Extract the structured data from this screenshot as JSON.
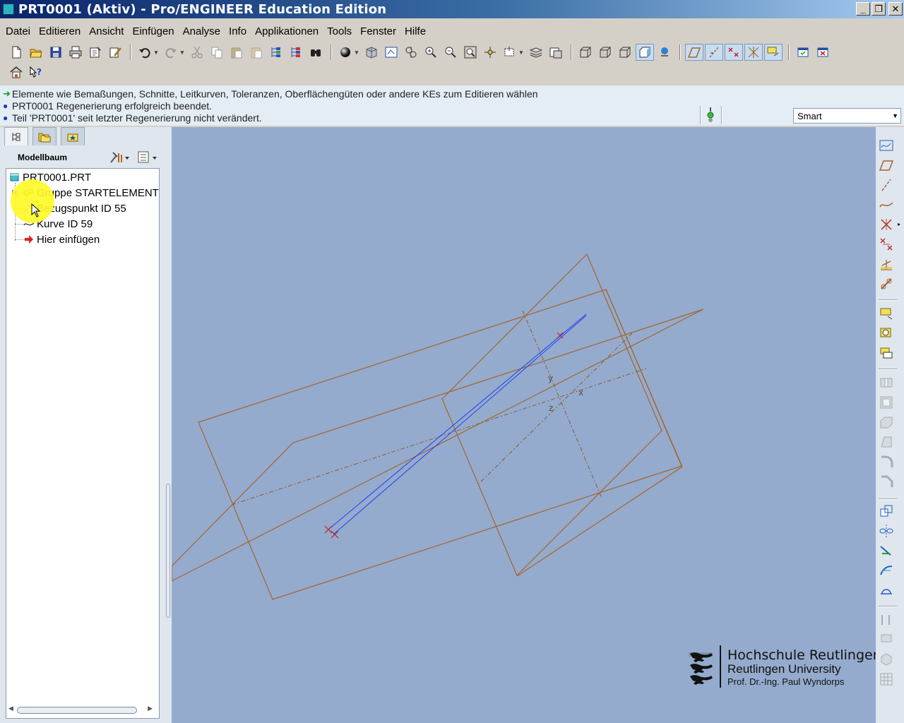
{
  "window": {
    "title": "PRT0001 (Aktiv) - Pro/ENGINEER Education Edition",
    "buttons": [
      "_",
      "❐",
      "✕"
    ]
  },
  "menubar": {
    "items": [
      "Datei",
      "Editieren",
      "Ansicht",
      "Einfügen",
      "Analyse",
      "Info",
      "Applikationen",
      "Tools",
      "Fenster",
      "Hilfe"
    ]
  },
  "toolbar_icons": {
    "file": [
      "new-icon",
      "open-icon",
      "save-icon",
      "print-icon",
      "send-icon",
      "mark-icon"
    ],
    "edit": [
      "undo-icon",
      "redo-icon",
      "cut-icon",
      "copy-icon",
      "paste-icon",
      "paste-special-icon",
      "regenerate-icon",
      "regen-manager-icon",
      "find-icon"
    ],
    "view": [
      "shade-icon",
      "view-manager-icon",
      "refit-icon",
      "reorient-icon",
      "zoom-in-icon",
      "zoom-out-icon",
      "zoom-window-icon",
      "spin-center-icon",
      "saved-views-icon",
      "layers-icon",
      "appearance-icon"
    ],
    "display": [
      "wireframe-icon",
      "hidden-line-icon",
      "no-hidden-icon",
      "shading-icon",
      "model-tree-display-icon"
    ],
    "datum": [
      "datum-planes-icon",
      "datum-axes-icon",
      "datum-points-icon",
      "coordinate-systems-icon",
      "annotations-icon"
    ],
    "window": [
      "activate-window-icon",
      "close-window-icon"
    ],
    "second_row": [
      "home-icon",
      "context-help-icon"
    ]
  },
  "messages": [
    {
      "type": "prompt",
      "text": "Elemente wie Bemaßungen, Schnitte, Leitkurven, Toleranzen, Oberflächengüten oder andere KEs zum Editieren wählen"
    },
    {
      "type": "info",
      "text": "PRT0001 Regenerierung erfolgreich beendet."
    },
    {
      "type": "info",
      "text": "Teil 'PRT0001' seit letzter Regenerierung nicht verändert."
    }
  ],
  "selection_filter": {
    "value": "Smart"
  },
  "navigator": {
    "tabs": [
      "model-tree-tab-icon",
      "folder-browser-tab-icon",
      "favorites-tab-icon"
    ],
    "header_label": "Modellbaum",
    "items": [
      {
        "label": "PRT0001.PRT",
        "icon": "part-icon"
      },
      {
        "label": "Gruppe STARTELEMENT",
        "icon": "group-icon"
      },
      {
        "label": "Bezugspunkt ID 55",
        "icon": "datum-point-icon"
      },
      {
        "label": "Kurve ID 59",
        "icon": "curve-icon"
      },
      {
        "label": "Hier einfügen",
        "icon": "insert-here-icon"
      }
    ]
  },
  "viewport": {
    "background": "#94abcd",
    "datum_color": "#a5642c",
    "curve_color": "#2040f0",
    "axis_labels": [
      "y",
      "x",
      "z"
    ]
  },
  "logo": {
    "line1": "Hochschule Reutlingen",
    "line2": "Reutlingen University",
    "line3": "Prof. Dr.-Ing. Paul Wyndorps"
  },
  "right_toolbar_icons": [
    "sketched-datum-curve-icon",
    "datum-plane-tool-icon",
    "datum-axis-tool-icon",
    "datum-curve-tool-icon",
    "datum-point-tool-icon",
    "offset-point-icon",
    "csys-tool-icon",
    "analysis-feature-icon",
    "extrude-tool-icon",
    "revolve-tool-icon",
    "variable-section-sweep-icon",
    "hole-tool-icon",
    "shell-tool-icon",
    "rib-tool-icon",
    "draft-tool-icon",
    "round-tool-icon",
    "chamfer-tool-icon",
    "copy-tool-icon",
    "mirror-tool-icon",
    "merge-tool-icon",
    "trim-tool-icon",
    "extend-tool-icon",
    "offset-tool-icon",
    "thicken-tool-icon",
    "solidify-tool-icon",
    "pattern-tool-icon"
  ]
}
